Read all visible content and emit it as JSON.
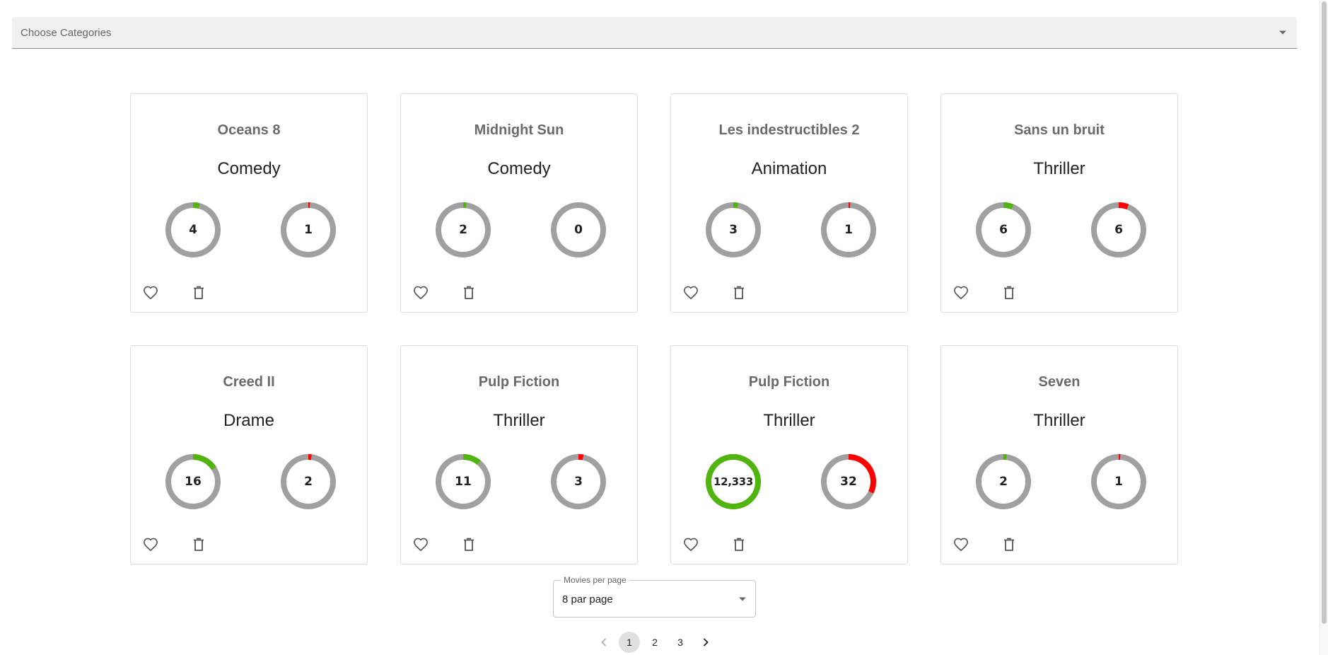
{
  "category_select": {
    "placeholder": "Choose Categories"
  },
  "colors": {
    "likes": "#52b40f",
    "dislikes": "#ff0000",
    "track": "#a0a0a0"
  },
  "movies": [
    {
      "title": "Oceans 8",
      "category": "Comedy",
      "likes": "4",
      "dislikes": "1",
      "likes_ratio": 0.04,
      "dislikes_ratio": 0.01
    },
    {
      "title": "Midnight Sun",
      "category": "Comedy",
      "likes": "2",
      "dislikes": "0",
      "likes_ratio": 0.02,
      "dislikes_ratio": 0
    },
    {
      "title": "Les indestructibles 2",
      "category": "Animation",
      "likes": "3",
      "dislikes": "1",
      "likes_ratio": 0.03,
      "dislikes_ratio": 0.01
    },
    {
      "title": "Sans un bruit",
      "category": "Thriller",
      "likes": "6",
      "dislikes": "6",
      "likes_ratio": 0.06,
      "dislikes_ratio": 0.06
    },
    {
      "title": "Creed II",
      "category": "Drame",
      "likes": "16",
      "dislikes": "2",
      "likes_ratio": 0.16,
      "dislikes_ratio": 0.02
    },
    {
      "title": "Pulp Fiction",
      "category": "Thriller",
      "likes": "11",
      "dislikes": "3",
      "likes_ratio": 0.11,
      "dislikes_ratio": 0.03
    },
    {
      "title": "Pulp Fiction",
      "category": "Thriller",
      "likes": "12,333",
      "dislikes": "32",
      "likes_ratio": 1.0,
      "dislikes_ratio": 0.32
    },
    {
      "title": "Seven",
      "category": "Thriller",
      "likes": "2",
      "dislikes": "1",
      "likes_ratio": 0.02,
      "dislikes_ratio": 0.01
    }
  ],
  "card_icons": {
    "like": "heart-outline-icon",
    "delete": "trash-icon"
  },
  "per_page": {
    "label": "Movies per page",
    "value": "8 par page"
  },
  "pagination": {
    "pages": [
      "1",
      "2",
      "3"
    ],
    "current": "1"
  }
}
